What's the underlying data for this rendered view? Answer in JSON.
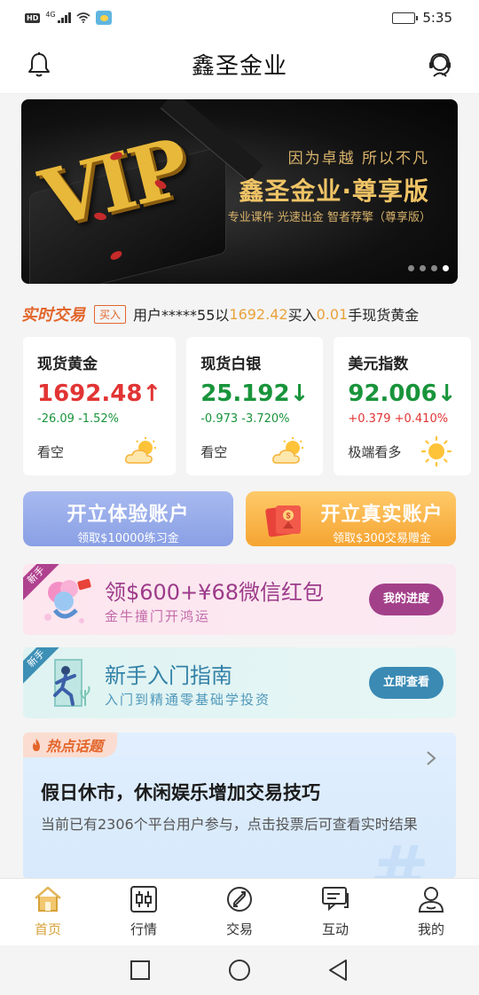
{
  "status_bar": {
    "network": "HD",
    "signal": "4G",
    "time": "5:35"
  },
  "header": {
    "title": "鑫圣金业",
    "left_icon": "bell-icon",
    "right_icon": "customer-service-icon"
  },
  "banner": {
    "vip_text": "VIP",
    "slogan": "因为卓越 所以不凡",
    "brand": "鑫圣金业·尊享版",
    "sub": "专业课件  光速出金  智者荐擎（尊享版）",
    "dots": 4,
    "active_dot": 3
  },
  "ticker": {
    "tag": "实时交易",
    "action": "买入",
    "text_pre": "用户*****55以",
    "price": "1692.42",
    "text_mid": "买入",
    "lots": "0.01",
    "text_post": "手现货黄金"
  },
  "quotes": [
    {
      "name": "现货黄金",
      "price": "1692.48",
      "arrow": "↑",
      "change": "-26.09  -1.52%",
      "price_color": "#e23434",
      "change_color": "#19943b",
      "view": "看空",
      "weather": "cloudy-sun-icon"
    },
    {
      "name": "现货白银",
      "price": "25.192",
      "arrow": "↓",
      "change": "-0.973  -3.720%",
      "price_color": "#19943b",
      "change_color": "#19943b",
      "view": "看空",
      "weather": "cloudy-sun-icon"
    },
    {
      "name": "美元指数",
      "price": "92.006",
      "arrow": "↓",
      "change": "+0.379  +0.410%",
      "price_color": "#19943b",
      "change_color": "#e23434",
      "view": "极端看多",
      "weather": "sun-icon"
    }
  ],
  "accounts": {
    "demo": {
      "title": "开立体验账户",
      "sub": "领取$10000练习金"
    },
    "real": {
      "title": "开立真实账户",
      "sub": "领取$300交易赠金"
    }
  },
  "promos": [
    {
      "corner": "新手",
      "title": "领$600+¥68微信红包",
      "sub": "金牛撞门开鸿运",
      "button": "我的进度"
    },
    {
      "corner": "新手",
      "title": "新手入门指南",
      "sub": "入门到精通零基础学投资",
      "button": "立即查看"
    }
  ],
  "topic": {
    "tag": "热点话题",
    "title": "假日休市，休闲娱乐增加交易技巧",
    "desc": "当前已有2306个平台用户参与，点击投票后可查看实时结果",
    "watermark": "#"
  },
  "tabbar": [
    {
      "label": "首页",
      "icon": "home-icon",
      "active": true
    },
    {
      "label": "行情",
      "icon": "candlestick-icon",
      "active": false
    },
    {
      "label": "交易",
      "icon": "trade-icon",
      "active": false
    },
    {
      "label": "互动",
      "icon": "chat-icon",
      "active": false
    },
    {
      "label": "我的",
      "icon": "user-icon",
      "active": false
    }
  ],
  "colors": {
    "accent": "#d6a238",
    "up": "#e23434",
    "down": "#19943b",
    "tag": "#e2662c"
  }
}
